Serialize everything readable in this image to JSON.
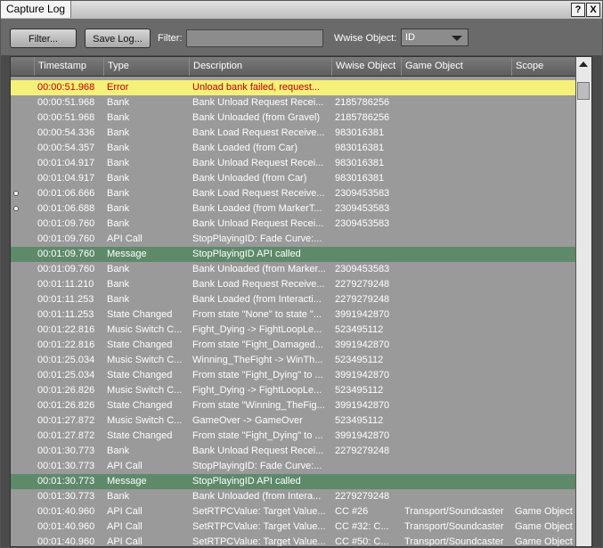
{
  "window": {
    "title": "Capture Log",
    "help_label": "?",
    "close_label": "X"
  },
  "toolbar": {
    "filter_button": "Filter...",
    "save_log_button": "Save Log...",
    "filter_label": "Filter:",
    "filter_value": "",
    "wwise_object_label": "Wwise Object:",
    "wwise_object_value": "ID"
  },
  "table": {
    "columns": [
      "Timestamp",
      "Type",
      "Description",
      "Wwise Object",
      "Game Object",
      "Scope"
    ],
    "rows": [
      {
        "kind": "error",
        "marker": false,
        "c": [
          "00:00:51.968",
          "Error",
          "Unload bank failed, request...",
          "",
          "",
          ""
        ]
      },
      {
        "kind": "",
        "marker": false,
        "c": [
          "00:00:51.968",
          "Bank",
          "Bank Unload Request Recei...",
          "2185786256",
          "",
          ""
        ]
      },
      {
        "kind": "",
        "marker": false,
        "c": [
          "00:00:51.968",
          "Bank",
          "Bank Unloaded (from Gravel)",
          "2185786256",
          "",
          ""
        ]
      },
      {
        "kind": "",
        "marker": false,
        "c": [
          "00:00:54.336",
          "Bank",
          "Bank Load Request Receive...",
          "983016381",
          "",
          ""
        ]
      },
      {
        "kind": "",
        "marker": false,
        "c": [
          "00:00:54.357",
          "Bank",
          "Bank Loaded (from Car)",
          "983016381",
          "",
          ""
        ]
      },
      {
        "kind": "",
        "marker": false,
        "c": [
          "00:01:04.917",
          "Bank",
          "Bank Unload Request Recei...",
          "983016381",
          "",
          ""
        ]
      },
      {
        "kind": "",
        "marker": false,
        "c": [
          "00:01:04.917",
          "Bank",
          "Bank Unloaded (from Car)",
          "983016381",
          "",
          ""
        ]
      },
      {
        "kind": "",
        "marker": true,
        "c": [
          "00:01:06.666",
          "Bank",
          "Bank Load Request Receive...",
          "2309453583",
          "",
          ""
        ]
      },
      {
        "kind": "",
        "marker": true,
        "c": [
          "00:01:06.688",
          "Bank",
          "Bank Loaded (from MarkerT...",
          "2309453583",
          "",
          ""
        ]
      },
      {
        "kind": "",
        "marker": false,
        "c": [
          "00:01:09.760",
          "Bank",
          "Bank Unload Request Recei...",
          "2309453583",
          "",
          ""
        ]
      },
      {
        "kind": "",
        "marker": false,
        "c": [
          "00:01:09.760",
          "API Call",
          "StopPlayingID: Fade Curve:...",
          "",
          "",
          ""
        ]
      },
      {
        "kind": "msg",
        "marker": false,
        "c": [
          "00:01:09.760",
          "Message",
          "StopPlayingID API called",
          "",
          "",
          ""
        ]
      },
      {
        "kind": "",
        "marker": false,
        "c": [
          "00:01:09.760",
          "Bank",
          "Bank Unloaded (from Marker...",
          "2309453583",
          "",
          ""
        ]
      },
      {
        "kind": "",
        "marker": false,
        "c": [
          "00:01:11.210",
          "Bank",
          "Bank Load Request Receive...",
          "2279279248",
          "",
          ""
        ]
      },
      {
        "kind": "",
        "marker": false,
        "c": [
          "00:01:11.253",
          "Bank",
          "Bank Loaded (from Interacti...",
          "2279279248",
          "",
          ""
        ]
      },
      {
        "kind": "",
        "marker": false,
        "c": [
          "00:01:11.253",
          "State Changed",
          "From state \"None\" to state \"...",
          "3991942870",
          "",
          ""
        ]
      },
      {
        "kind": "",
        "marker": false,
        "c": [
          "00:01:22.816",
          "Music Switch C...",
          "Fight_Dying -> FightLoopLe...",
          "523495112",
          "",
          ""
        ]
      },
      {
        "kind": "",
        "marker": false,
        "c": [
          "00:01:22.816",
          "State Changed",
          "From state \"Fight_Damaged...",
          "3991942870",
          "",
          ""
        ]
      },
      {
        "kind": "",
        "marker": false,
        "c": [
          "00:01:25.034",
          "Music Switch C...",
          "Winning_TheFight -> WinTh...",
          "523495112",
          "",
          ""
        ]
      },
      {
        "kind": "",
        "marker": false,
        "c": [
          "00:01:25.034",
          "State Changed",
          "From state \"Fight_Dying\" to ...",
          "3991942870",
          "",
          ""
        ]
      },
      {
        "kind": "",
        "marker": false,
        "c": [
          "00:01:26.826",
          "Music Switch C...",
          "Fight_Dying -> FightLoopLe...",
          "523495112",
          "",
          ""
        ]
      },
      {
        "kind": "",
        "marker": false,
        "c": [
          "00:01:26.826",
          "State Changed",
          "From state \"Winning_TheFig...",
          "3991942870",
          "",
          ""
        ]
      },
      {
        "kind": "",
        "marker": false,
        "c": [
          "00:01:27.872",
          "Music Switch C...",
          "GameOver -> GameOver",
          "523495112",
          "",
          ""
        ]
      },
      {
        "kind": "",
        "marker": false,
        "c": [
          "00:01:27.872",
          "State Changed",
          "From state \"Fight_Dying\" to ...",
          "3991942870",
          "",
          ""
        ]
      },
      {
        "kind": "",
        "marker": false,
        "c": [
          "00:01:30.773",
          "Bank",
          "Bank Unload Request Recei...",
          "2279279248",
          "",
          ""
        ]
      },
      {
        "kind": "",
        "marker": false,
        "c": [
          "00:01:30.773",
          "API Call",
          "StopPlayingID: Fade Curve:...",
          "",
          "",
          ""
        ]
      },
      {
        "kind": "msg",
        "marker": false,
        "c": [
          "00:01:30.773",
          "Message",
          "StopPlayingID API called",
          "",
          "",
          ""
        ]
      },
      {
        "kind": "",
        "marker": false,
        "c": [
          "00:01:30.773",
          "Bank",
          "Bank Unloaded (from Intera...",
          "2279279248",
          "",
          ""
        ]
      },
      {
        "kind": "",
        "marker": false,
        "c": [
          "00:01:40.960",
          "API Call",
          "SetRTPCValue: Target Value...",
          "CC #26",
          "Transport/Soundcaster",
          "Game Object"
        ]
      },
      {
        "kind": "",
        "marker": false,
        "c": [
          "00:01:40.960",
          "API Call",
          "SetRTPCValue: Target Value...",
          "CC #32: C...",
          "Transport/Soundcaster",
          "Game Object"
        ]
      },
      {
        "kind": "",
        "marker": false,
        "c": [
          "00:01:40.960",
          "API Call",
          "SetRTPCValue: Target Value...",
          "CC #50: C...",
          "Transport/Soundcaster",
          "Game Object"
        ]
      }
    ]
  },
  "colors": {
    "error_row_bg": "#f5f07a",
    "error_text": "#c00000",
    "message_row_bg": "#5e8a6a"
  }
}
